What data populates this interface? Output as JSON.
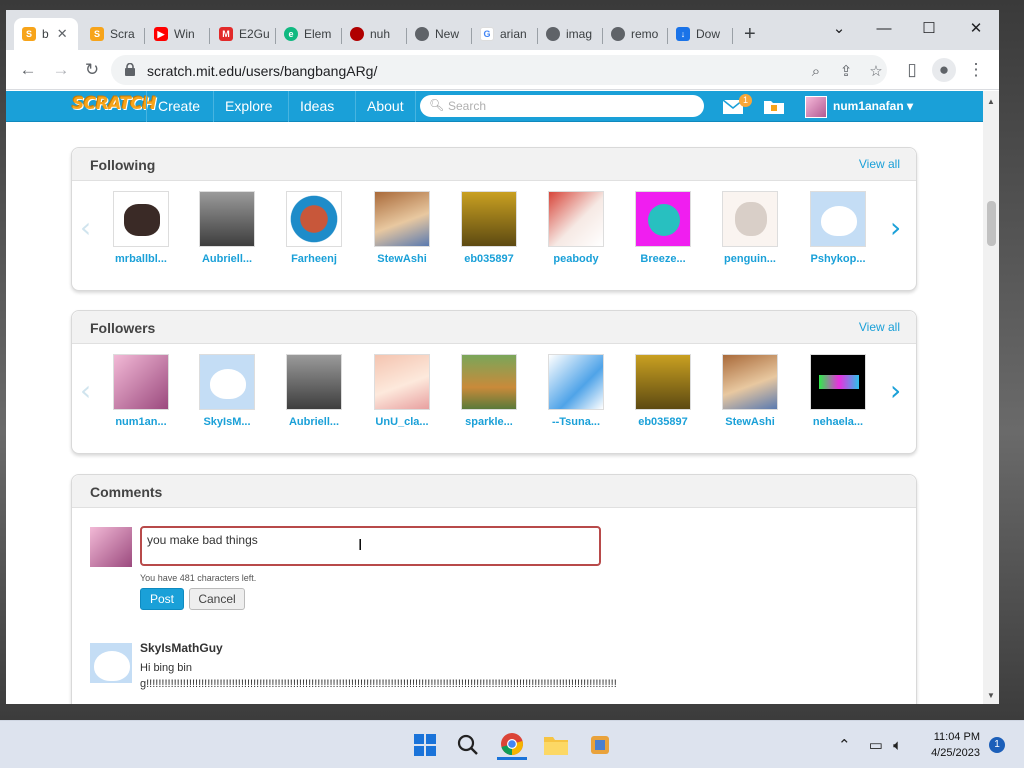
{
  "browser": {
    "tabs": [
      {
        "label": "b",
        "favicon": "scratch-icon",
        "color": "#f7a41a",
        "active": true
      },
      {
        "label": "Scra",
        "favicon": "scratch-icon",
        "color": "#f7a41a"
      },
      {
        "label": "Win",
        "favicon": "youtube-icon",
        "color": "#ff0000"
      },
      {
        "label": "E2Gu",
        "favicon": "m-icon",
        "color": "#e22a2a"
      },
      {
        "label": "Elem",
        "favicon": "element-icon",
        "color": "#10b981"
      },
      {
        "label": "nuh",
        "favicon": "red-circle-icon",
        "color": "#b00000"
      },
      {
        "label": "New",
        "favicon": "chrome-icon",
        "color": "#5f6368"
      },
      {
        "label": "arian",
        "favicon": "google-icon",
        "color": "#4285f4"
      },
      {
        "label": "imag",
        "favicon": "globe-icon",
        "color": "#5f6368"
      },
      {
        "label": "remo",
        "favicon": "globe-icon",
        "color": "#5f6368"
      },
      {
        "label": "Dow",
        "favicon": "download-icon",
        "color": "#1a73e8"
      }
    ],
    "url": "scratch.mit.edu/users/bangbangARg/"
  },
  "scratch_nav": {
    "logo": "SCRATCH",
    "links": [
      "Create",
      "Explore",
      "Ideas",
      "About"
    ],
    "search_placeholder": "Search",
    "message_count": "1",
    "username": "num1anafan ▾"
  },
  "following": {
    "title": "Following",
    "view_all": "View all",
    "users": [
      "mrballbl...",
      "Aubriell...",
      "Farheenj",
      "StewAshi",
      "eb035897",
      "peabody",
      "Breeze...",
      "penguin...",
      "Pshykop..."
    ]
  },
  "followers": {
    "title": "Followers",
    "view_all": "View all",
    "users": [
      "num1an...",
      "SkyIsM...",
      "Aubriell...",
      "UnU_cla...",
      "sparkle...",
      "--Tsuna...",
      "eb035897",
      "StewAshi",
      "nehaela..."
    ]
  },
  "comments": {
    "title": "Comments",
    "draft": "you make bad things",
    "chars_left": "You have 481 characters left.",
    "post_label": "Post",
    "cancel_label": "Cancel",
    "items": [
      {
        "author": "SkyIsMathGuy",
        "text": "Hi bing bing!!!!!!!!!!!!!!!!!!!!!!!!!!!!!!!!!!!!!!!!!!!!!!!!!!!!!!!!!!!!!!!!!!!!!!!!!!!!!!!!!!!!!!!!!!!!!!!!!!!!!!!!!!!!!!!!!!!!!!!!!!!!!!!!!!!!!!!!!!!!!!!!!!!!!!!!!!"
      }
    ]
  },
  "taskbar": {
    "time": "11:04 PM",
    "date": "4/25/2023",
    "notifications": "1"
  }
}
